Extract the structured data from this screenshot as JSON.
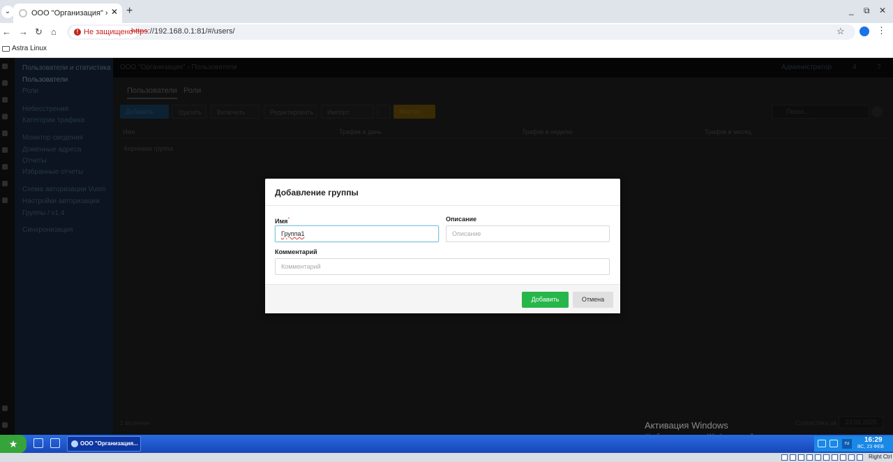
{
  "browser": {
    "tab_title": "ООО \"Организация\" › Пол",
    "security_label": "Не защищено",
    "url_scheme": "https",
    "url_rest": "://192.168.0.1:81/#/users/",
    "bookmark": "Astra Linux"
  },
  "app": {
    "sidebar": {
      "items": [
        "Пользователи и статистика",
        "Пользователи",
        "Роли",
        "Небесстрения",
        "Категории трафика",
        "Монитор сведения",
        "Доменные адреса",
        "Отчеты",
        "Избранные отчеты",
        "Схема авторизации Vusm",
        "Настройки авторизации",
        "Группы / v1.4",
        "Синхронизация"
      ]
    },
    "breadcrumb": "ООО \"Организация\" › Пользователи",
    "topbar_user": "Администратор",
    "topbar_count": "4",
    "tabs": [
      "Пользователи",
      "Роли"
    ],
    "toolbar": {
      "add": "Добавить",
      "delete": "Удалить",
      "enable": "Включить",
      "edit": "Редактировать",
      "import": "Импорт",
      "master": "Мастер",
      "search_placeholder": "Поиск..."
    },
    "table": {
      "columns": [
        "Имя",
        "Трафик в день",
        "Трафик в неделю",
        "Трафик в месяц"
      ],
      "root_group": "Корневая группа"
    },
    "footer": {
      "count": "1 включен",
      "stats_label": "Статистика за",
      "stats_date": "23.02.2025"
    }
  },
  "modal": {
    "title": "Добавление группы",
    "name_label": "Имя",
    "name_required": "*",
    "name_value": "Группа1",
    "desc_label": "Описание",
    "desc_placeholder": "Описание",
    "comment_label": "Комментарий",
    "comment_placeholder": "Комментарий",
    "add_button": "Добавить",
    "cancel_button": "Отмена"
  },
  "watermark": {
    "title": "Активация Windows",
    "subtitle": "Чтобы активировать Windows, перейдите в раздел"
  },
  "taskbar": {
    "task_label": "ООО \"Организация...",
    "lang": "ru",
    "time": "16:29",
    "date": "ВС, 23 ФЕВ"
  },
  "vm_status": {
    "host_key": "Right Ctrl"
  },
  "colors": {
    "add_button": "#27b64a",
    "insecure": "#c5221f",
    "taskbar": "#1f56cc"
  }
}
